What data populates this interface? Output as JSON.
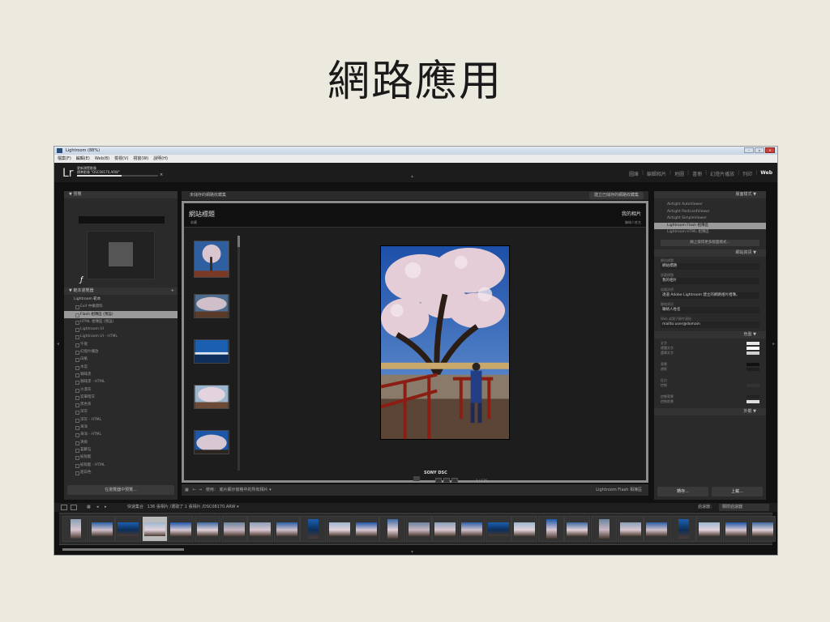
{
  "slide": {
    "title": "網路應用"
  },
  "window": {
    "title": "Lightroom (88%)",
    "menu": [
      "檔案(F)",
      "編輯(E)",
      "Web(B)",
      "檢視(V)",
      "視窗(W)",
      "說明(H)"
    ]
  },
  "identity": {
    "logo": "Lr",
    "progress_line1": "更新預覽影像",
    "progress_line2": "標準影像 \"DSC08170.ARW\"",
    "progress_fraction": 0.55
  },
  "modules": [
    "圖庫",
    "編輯相片",
    "地圖",
    "書冊",
    "幻燈片播放",
    "列印",
    "Web"
  ],
  "active_module": "Web",
  "left_panel": {
    "preview_header": "預覽",
    "template_header": "範本瀏覽器",
    "templates": [
      "Lightroom 範本",
      "Exif 中繼資料",
      "Flash 相簿區 (預設)",
      "HTML 相簿區 (預設)",
      "Lightroom UI",
      "Lightroom UI - HTML",
      "午夜",
      "幻燈片播放",
      "白紙",
      "木炭",
      "咖啡黑",
      "咖啡黑 - HTML",
      "沙漠灰",
      "炭筆暗灰",
      "黑色系",
      "深灰",
      "深灰 - HTML",
      "海洋",
      "海洋 - HTML",
      "清爽",
      "苔蘚石",
      "紡殼藍",
      "紡殼藍 - HTML",
      "鋁白色"
    ],
    "selected_template": "Flash 相簿區 (預設)",
    "button": "在瀏覽器中預覽..."
  },
  "center": {
    "header": "未儲存的網路收藏集",
    "create_button": "建立已儲存的網路收藏集",
    "site_title": "網站標題",
    "site_subtitle": "收藏",
    "my_photos": "我的相片",
    "contact": "聯絡人姓名",
    "caption": "SONY DSC",
    "counter": "1 / 136",
    "toolbar_use": "使用：",
    "toolbar_scope": "底片顯示窗格中的所有相片",
    "toolbar_right": "Lightroom Flash 相簿區"
  },
  "right_panel": {
    "layout_header": "版面樣式",
    "layouts": [
      "Airtight AutoViewer",
      "Airtight PostcardViewer",
      "Airtight SimpleViewer",
      "Lightroom Flash 相簿區",
      "Lightroom HTML 相簿區"
    ],
    "selected_layout": "Lightroom Flash 相簿區",
    "get_more": "線上取得更多版面樣式...",
    "site_info_header": "網站資訊",
    "fields": [
      {
        "label": "網站標題",
        "value": "網站標題"
      },
      {
        "label": "收藏標題",
        "value": "我的相片"
      },
      {
        "label": "收藏說明",
        "value": "透過 Adobe Lightroom 建立的網路相片相簿。"
      },
      {
        "label": "聯絡資訊",
        "value": "聯絡人姓名"
      },
      {
        "label": "Web 或電子郵件連結",
        "value": "mailto:user@domain"
      }
    ],
    "colors_header": "色盤",
    "color_rows": [
      {
        "label": "文字",
        "color": "#e6e6e6"
      },
      {
        "label": "標題文字",
        "color": "#ffffff"
      },
      {
        "label": "選單文字",
        "color": "#d0d0d0"
      },
      {
        "label": "背景",
        "color": "#111111"
      },
      {
        "label": "邊框",
        "color": "#1e1e1e"
      },
      {
        "label": "反白",
        "color": "#2a2a2a"
      },
      {
        "label": "控制",
        "color": "#333333"
      },
      {
        "label": "控制背景",
        "color": "#222222"
      },
      {
        "label": "控制前景",
        "color": "#dddddd"
      }
    ],
    "appearance_header": "外觀",
    "export_button": "轉存...",
    "upload_button": "上載..."
  },
  "filmbar": {
    "source": "快速集合",
    "count": "136 張相片 /選取了 1 張相片 /DSC08170.ARW ▾",
    "filter_label": "過濾器：",
    "filter_value": "關閉過濾器"
  },
  "filmstrip_count": 27,
  "filmstrip_selected": 3
}
